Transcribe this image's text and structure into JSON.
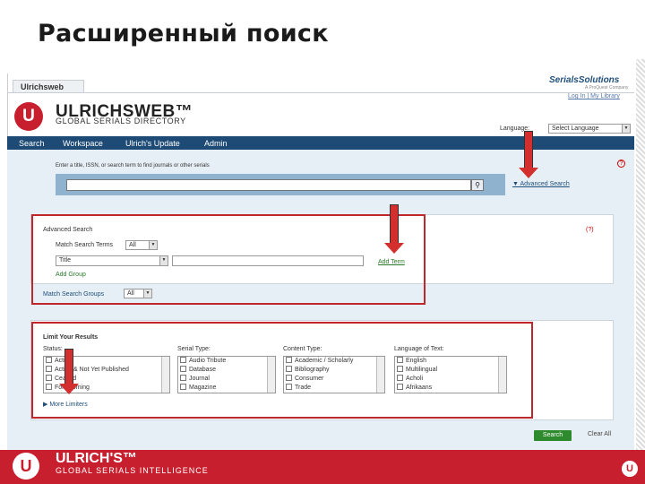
{
  "slide_title": "Расширенный поиск",
  "browser": {
    "tab_label": "Ulrichsweb",
    "brand": "SerialsSolutions",
    "brand_sub": "A ProQuest Company",
    "logout": "Log In  |  My Library"
  },
  "header": {
    "logo_title": "ULRICHSWEB™",
    "logo_sub": "GLOBAL SERIALS DIRECTORY",
    "language_label": "Language:",
    "language_select": "Select Language"
  },
  "nav": [
    "Search",
    "Workspace",
    "Ulrich's Update",
    "Admin"
  ],
  "quick_search": {
    "hint": "Enter a title, ISSN, or search term to find journals or other serials",
    "advanced_link": "▼ Advanced Search",
    "help": "?"
  },
  "advanced": {
    "title": "Advanced Search",
    "match_terms_label": "Match Search Terms",
    "match_terms_value": "All",
    "field_value": "Title",
    "add_term": "Add Term",
    "add_group": "Add Group",
    "match_groups_label": "Match Search Groups",
    "match_groups_value": "All",
    "help": "(?)"
  },
  "limits": {
    "title": "Limit Your Results",
    "columns": [
      {
        "title": "Status:",
        "options": [
          "Active",
          "Active & Not Yet Published",
          "Ceased",
          "Forthcoming"
        ]
      },
      {
        "title": "Serial Type:",
        "options": [
          "Audio Tribute",
          "Database",
          "Journal",
          "Magazine"
        ]
      },
      {
        "title": "Content Type:",
        "options": [
          "Academic / Scholarly",
          "Bibliography",
          "Consumer",
          "Trade"
        ]
      },
      {
        "title": "Language of Text:",
        "options": [
          "English",
          "Multilingual",
          "Acholi",
          "Afrikaans"
        ]
      }
    ],
    "more": "▶ More Limiters"
  },
  "actions": {
    "search": "Search",
    "clear": "Clear All"
  },
  "footer": {
    "logo_title": "ULRICH'S™",
    "logo_sub": "GLOBAL SERIALS INTELLIGENCE",
    "logo_letter": "U"
  },
  "colors": {
    "accent": "#c81f2f",
    "nav": "#1e4b75",
    "highlight": "#c0272d"
  }
}
